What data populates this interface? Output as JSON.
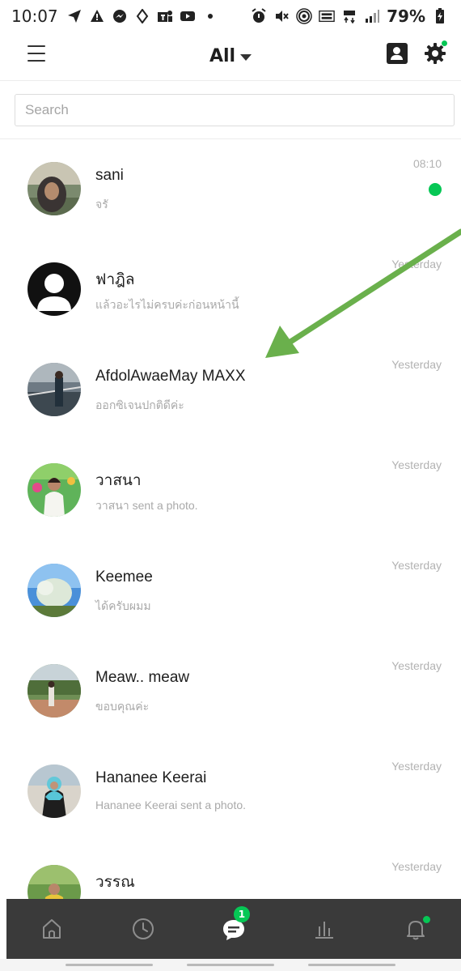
{
  "status_bar": {
    "time": "10:07",
    "battery": "79%",
    "left_icons": [
      "send-icon",
      "warning-icon",
      "messenger-icon",
      "location-icon",
      "teams-icon",
      "youtube-icon",
      "dot-icon"
    ],
    "right_icons": [
      "alarm-icon",
      "mute-icon",
      "hotspot-icon",
      "volte-icon",
      "4g-icon",
      "signal-icon",
      "battery-icon"
    ]
  },
  "header": {
    "title": "All",
    "menu_icon": "hamburger-icon",
    "contacts_icon": "contacts-icon",
    "settings_icon": "gear-icon"
  },
  "search": {
    "placeholder": "Search",
    "value": ""
  },
  "chats": [
    {
      "name": "sani",
      "preview": "จรั",
      "time": "08:10",
      "unread": true
    },
    {
      "name": "ฟาฎิล",
      "preview": "แล้วอะไรไม่ครบค่ะก่อนหน้านี้",
      "time": "Yesterday",
      "unread": false
    },
    {
      "name": "AfdolAwaeMay MAXX",
      "preview": "ออกซิเจนปกติดีค่ะ",
      "time": "Yesterday",
      "unread": false
    },
    {
      "name": "วาสนา",
      "preview": "วาสนา sent a photo.",
      "time": "Yesterday",
      "unread": false
    },
    {
      "name": "Keemee",
      "preview": "ได้ครับผมม",
      "time": "Yesterday",
      "unread": false
    },
    {
      "name": "Meaw.. meaw",
      "preview": "ขอบคุณค่ะ",
      "time": "Yesterday",
      "unread": false
    },
    {
      "name": "Hananee Keerai",
      "preview": "Hananee Keerai sent a photo.",
      "time": "Yesterday",
      "unread": false
    },
    {
      "name": "วรรณ",
      "preview": "",
      "time": "Yesterday",
      "unread": false
    }
  ],
  "bottom_nav": {
    "items": [
      "home-icon",
      "clock-icon",
      "chat-icon",
      "chart-icon",
      "bell-icon"
    ],
    "chat_badge": "1"
  },
  "colors": {
    "accent_green": "#06c755",
    "nav_background": "#3a3a3a",
    "annotation_arrow": "#6ab04c"
  }
}
